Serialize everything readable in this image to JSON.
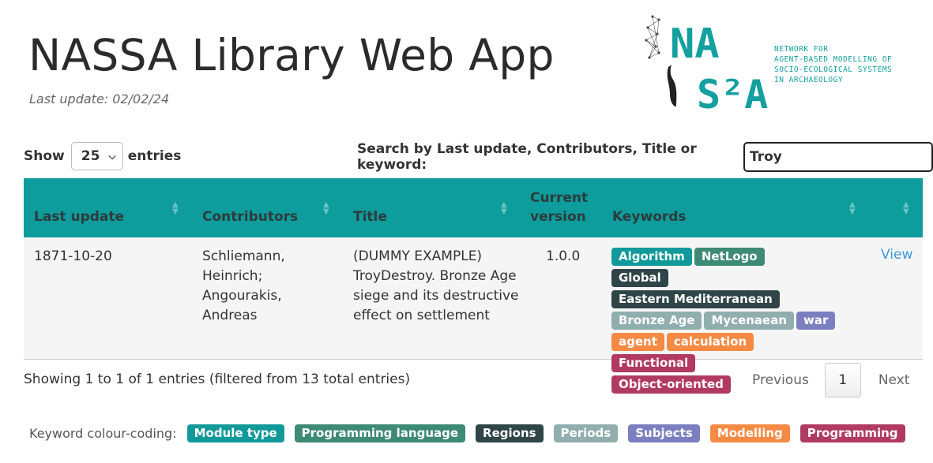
{
  "header": {
    "title": "NASSA Library Web App",
    "last_update": "Last update: 02/02/24"
  },
  "logo": {
    "letters_top": "NA",
    "letters_bottom": "S²A",
    "tagline": [
      "NETWORK FOR",
      "AGENT-BASED MODELLING OF",
      "SOCIO-ECOLOGICAL SYSTEMS",
      "IN ARCHAEOLOGY"
    ],
    "color": "#15a0a0"
  },
  "controls": {
    "show_label": "Show",
    "entries_value": "25",
    "entries_label": "entries",
    "search_label": "Search by Last update, Contributors, Title or keyword:",
    "search_value": "Troy"
  },
  "table": {
    "columns": [
      "Last update",
      "Contributors",
      "Title",
      "Current version",
      "Keywords",
      ""
    ],
    "rows": [
      {
        "last_update": "1871-10-20",
        "contributors": [
          "Schliemann,",
          "Heinrich;",
          "Angourakis,",
          "Andreas"
        ],
        "title": [
          "(DUMMY EXAMPLE)",
          "TroyDestroy. Bronze Age",
          "siege and its destructive",
          "effect on settlement"
        ],
        "version": "1.0.0",
        "keywords": [
          {
            "label": "Algorithm",
            "color": "#12999a"
          },
          {
            "label": "NetLogo",
            "color": "#3d8a75"
          },
          {
            "label": "Global",
            "color": "#2f4548"
          },
          {
            "label": "Eastern Mediterranean",
            "color": "#2f4548"
          },
          {
            "label": "Bronze Age",
            "color": "#91aeae"
          },
          {
            "label": "Mycenaean",
            "color": "#91aeae"
          },
          {
            "label": "war",
            "color": "#7b7fc0"
          },
          {
            "label": "agent",
            "color": "#f58a44"
          },
          {
            "label": "calculation",
            "color": "#f58a44"
          },
          {
            "label": "Functional",
            "color": "#b13a63"
          },
          {
            "label": "Object-oriented",
            "color": "#b13a63"
          }
        ],
        "action": "View"
      }
    ]
  },
  "footer": {
    "info": "Showing 1 to 1 of 1 entries (filtered from 13 total entries)",
    "previous": "Previous",
    "page": "1",
    "next": "Next"
  },
  "legend": {
    "label": "Keyword colour-coding:",
    "items": [
      {
        "label": "Module type",
        "color": "#12999a"
      },
      {
        "label": "Programming language",
        "color": "#3d8a75"
      },
      {
        "label": "Regions",
        "color": "#2f4548"
      },
      {
        "label": "Periods",
        "color": "#91aeae"
      },
      {
        "label": "Subjects",
        "color": "#7b7fc0"
      },
      {
        "label": "Modelling",
        "color": "#f58a44"
      },
      {
        "label": "Programming",
        "color": "#b13a63"
      }
    ]
  }
}
